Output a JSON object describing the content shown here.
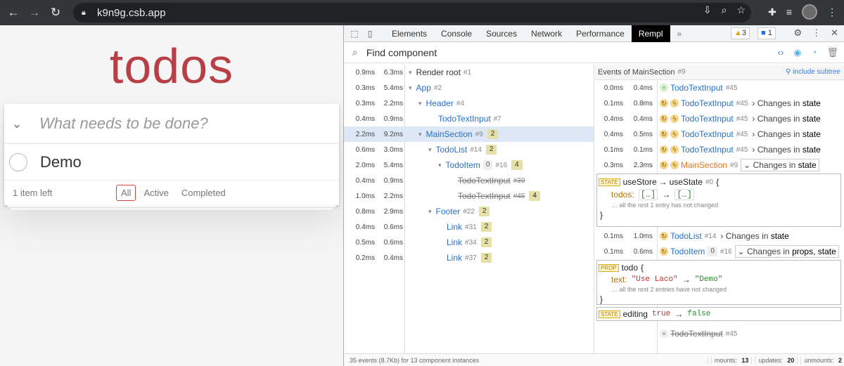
{
  "browser": {
    "url": "k9n9g.csb.app"
  },
  "app": {
    "title": "todos",
    "new_todo_placeholder": "What needs to be done?",
    "todo_item": "Demo",
    "items_left": "1 item left",
    "filters": [
      "All",
      "Active",
      "Completed"
    ],
    "selected_filter": "All"
  },
  "devtools": {
    "tabs": [
      "Elements",
      "Console",
      "Sources",
      "Network",
      "Performance",
      "Rempl"
    ],
    "active_tab": "Rempl",
    "more": "»",
    "warnings": "3",
    "messages": "1",
    "search_placeholder": "Find component",
    "tree": [
      {
        "t1": "0.9ms",
        "t2": "6.3ms",
        "name": "Render root",
        "id": "#1",
        "count": "",
        "count0": "",
        "strike": false,
        "root": true
      },
      {
        "t1": "0.3ms",
        "t2": "5.4ms",
        "name": "App",
        "id": "#2",
        "count": "",
        "count0": "",
        "strike": false
      },
      {
        "t1": "0.3ms",
        "t2": "2.2ms",
        "name": "Header",
        "id": "#4",
        "count": "",
        "count0": "",
        "strike": false
      },
      {
        "t1": "0.4ms",
        "t2": "0.9ms",
        "name": "TodoTextInput",
        "id": "#7",
        "count": "",
        "count0": "",
        "strike": false
      },
      {
        "t1": "2.2ms",
        "t2": "9.2ms",
        "name": "MainSection",
        "id": "#9",
        "count": "2",
        "count0": "",
        "strike": false
      },
      {
        "t1": "0.6ms",
        "t2": "3.0ms",
        "name": "TodoList",
        "id": "#14",
        "count": "2",
        "count0": "",
        "strike": false
      },
      {
        "t1": "2.0ms",
        "t2": "5.4ms",
        "name": "TodoItem",
        "id": "#16",
        "count": "4",
        "count0": "0",
        "strike": false
      },
      {
        "t1": "0.4ms",
        "t2": "0.9ms",
        "name": "TodoTextInput",
        "id": "#39",
        "count": "",
        "count0": "",
        "strike": true
      },
      {
        "t1": "1.0ms",
        "t2": "2.2ms",
        "name": "TodoTextInput",
        "id": "#45",
        "count": "4",
        "count0": "",
        "strike": true
      },
      {
        "t1": "0.8ms",
        "t2": "2.9ms",
        "name": "Footer",
        "id": "#22",
        "count": "2",
        "count0": "",
        "strike": false
      },
      {
        "t1": "0.4ms",
        "t2": "0.6ms",
        "name": "Link",
        "id": "#31",
        "count": "2",
        "count0": "",
        "strike": false
      },
      {
        "t1": "0.5ms",
        "t2": "0.6ms",
        "name": "Link",
        "id": "#34",
        "count": "2",
        "count0": "",
        "strike": false
      },
      {
        "t1": "0.2ms",
        "t2": "0.4ms",
        "name": "Link",
        "id": "#37",
        "count": "2",
        "count0": "",
        "strike": false
      }
    ],
    "events_header": "Events of MainSection",
    "events_header_id": "#9",
    "include_subtree": "include subtree",
    "events": [
      {
        "t1": "0.0ms",
        "t2": "0.4ms",
        "name": "TodoTextInput",
        "id": "#45",
        "kind": "mount"
      },
      {
        "t1": "0.1ms",
        "t2": "0.8ms",
        "name": "TodoTextInput",
        "id": "#45",
        "kind": "update",
        "changes_prefix": "Changes in",
        "changes": "state"
      },
      {
        "t1": "0.4ms",
        "t2": "0.4ms",
        "name": "TodoTextInput",
        "id": "#45",
        "kind": "update",
        "changes_prefix": "Changes in",
        "changes": "state"
      },
      {
        "t1": "0.4ms",
        "t2": "0.5ms",
        "name": "TodoTextInput",
        "id": "#45",
        "kind": "update",
        "changes_prefix": "Changes in",
        "changes": "state"
      },
      {
        "t1": "0.1ms",
        "t2": "0.1ms",
        "name": "TodoTextInput",
        "id": "#45",
        "kind": "update",
        "changes_prefix": "Changes in",
        "changes": "state"
      },
      {
        "t1": "0.3ms",
        "t2": "2.3ms",
        "name": "MainSection",
        "id": "#9",
        "kind": "update",
        "changes_prefix": "Changes in",
        "changes": "state"
      },
      {
        "t1": "0.1ms",
        "t2": "1.0ms",
        "name": "TodoList",
        "id": "#14",
        "kind": "update",
        "changes_prefix": "Changes in",
        "changes": "state"
      },
      {
        "t1": "0.1ms",
        "t2": "0.6ms",
        "name": "TodoItem",
        "id": "#16",
        "count0": "0",
        "kind": "update",
        "changes_prefix": "Changes in",
        "changes": "props, state"
      },
      {
        "name": "TodoTextInput",
        "id": "#45",
        "kind": "unmount"
      }
    ],
    "state_box": {
      "tag": "STATE",
      "hook1": "useStore",
      "hook2": "useState",
      "hook_id": "#0",
      "key": "todos:",
      "from": "[…]",
      "to": "[…]",
      "note": "… all the rest 1 entry has not changed"
    },
    "prop_box": {
      "tag": "PROP",
      "name": "todo",
      "key": "text:",
      "from": "\"Use Laco\"",
      "to": "\"Demo\"",
      "note": "… all the rest 2 entries have not changed"
    },
    "state_box2": {
      "tag": "STATE",
      "name": "editing",
      "from": "true",
      "to": "false"
    },
    "status": {
      "summary": "35 events (8.7Kb) for 13 component instances",
      "mounts_label": "mounts:",
      "mounts": "13",
      "updates_label": "updates:",
      "updates": "20",
      "unmounts_label": "unmounts:",
      "unmounts": "2"
    }
  }
}
